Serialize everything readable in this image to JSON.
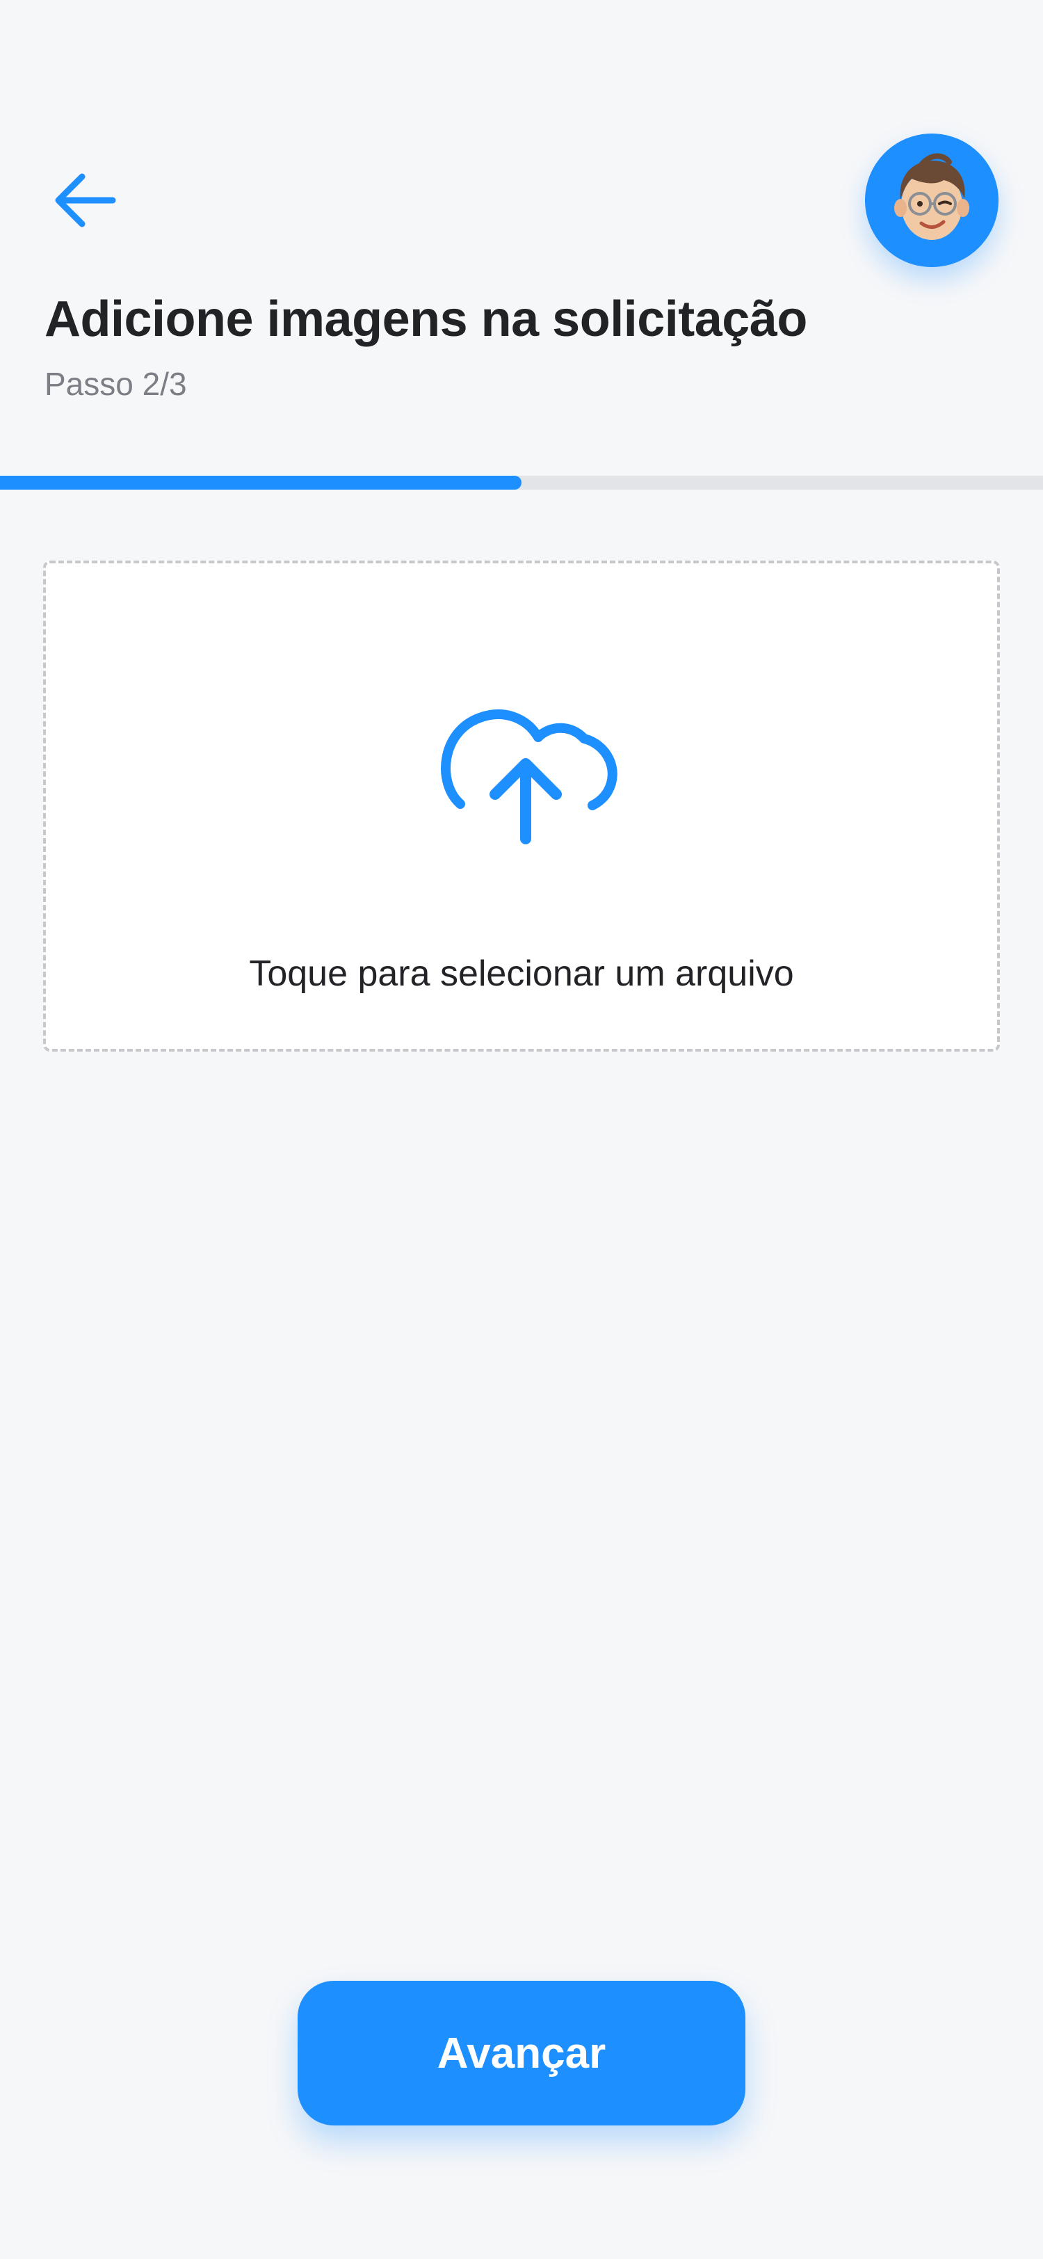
{
  "header": {
    "back_icon": "arrow-left-icon",
    "avatar_icon": "memoji-avatar-icon",
    "title": "Adicione imagens na solicitação",
    "step": "Passo 2/3"
  },
  "progress": {
    "current_step": 2,
    "total_steps": 3,
    "fraction": 0.5
  },
  "upload": {
    "icon": "cloud-upload-icon",
    "label": "Toque para selecionar um arquivo"
  },
  "footer": {
    "advance_label": "Avançar"
  },
  "colors": {
    "accent": "#1E8FFF",
    "background": "#F6F7F9",
    "title_text": "#222326",
    "muted_text": "#7B7E84",
    "progress_track": "#E3E4E7",
    "dashed_border": "#C7C8CB"
  }
}
